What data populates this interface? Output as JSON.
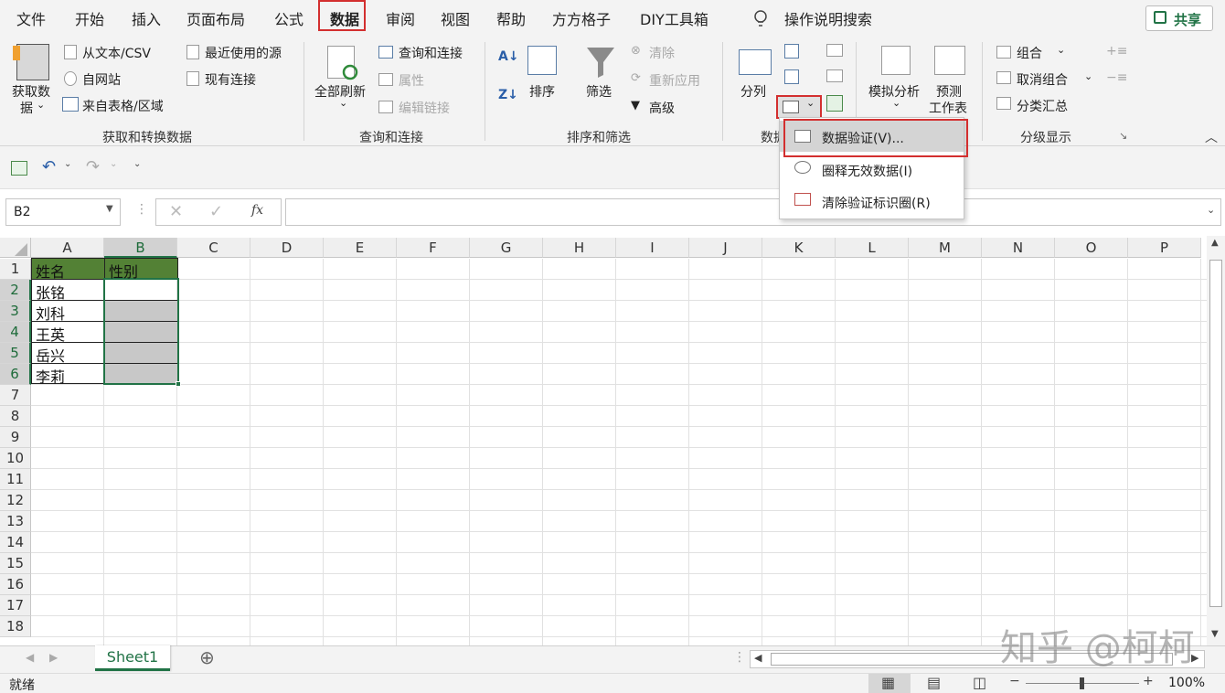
{
  "tabs": [
    "文件",
    "开始",
    "插入",
    "页面布局",
    "公式",
    "数据",
    "审阅",
    "视图",
    "帮助",
    "方方格子",
    "DIY工具箱"
  ],
  "tell_me": "操作说明搜索",
  "share": "共享",
  "ribbon": {
    "get_data": "获取数",
    "get_data2": "据",
    "from_text": "从文本/CSV",
    "from_web": "自网站",
    "from_table": "来自表格/区域",
    "recent_sources": "最近使用的源",
    "existing_conn": "现有连接",
    "group_get": "获取和转换数据",
    "refresh_all": "全部刷新",
    "queries_conn": "查询和连接",
    "properties": "属性",
    "edit_links": "编辑链接",
    "group_queries": "查询和连接",
    "sort": "排序",
    "filter": "筛选",
    "clear": "清除",
    "reapply": "重新应用",
    "advanced": "高级",
    "group_sort": "排序和筛选",
    "text_to_col": "分列",
    "group_data_tools": "数据",
    "what_if": "模拟分析",
    "forecast1": "预测",
    "forecast2": "工作表",
    "group_btn": "组合",
    "ungroup": "取消组合",
    "subtotal": "分类汇总",
    "group_outline": "分级显示"
  },
  "dropdown": {
    "item1": "数据验证(V)...",
    "item2": "圈释无效数据(I)",
    "item3": "清除验证标识圈(R)"
  },
  "namebox": "B2",
  "fx": "fx",
  "columns": [
    "A",
    "B",
    "C",
    "D",
    "E",
    "F",
    "G",
    "H",
    "I",
    "J",
    "K",
    "L",
    "M",
    "N",
    "O",
    "P"
  ],
  "rows": [
    "1",
    "2",
    "3",
    "4",
    "5",
    "6",
    "7",
    "8",
    "9",
    "10",
    "11",
    "12",
    "13",
    "14",
    "15",
    "16",
    "17",
    "18"
  ],
  "cells": {
    "a1": "姓名",
    "b1": "性别",
    "a2": "张铭",
    "a3": "刘科",
    "a4": "王英",
    "a5": "岳兴",
    "a6": "李莉"
  },
  "sheet_tab": "Sheet1",
  "status": "就绪",
  "zoom": "100%",
  "watermark": "知乎 @柯柯",
  "colors": {
    "accent": "#217346",
    "highlight": "#d32f2f",
    "header_fill": "#538135",
    "selection_fill": "#c8c8c8"
  }
}
